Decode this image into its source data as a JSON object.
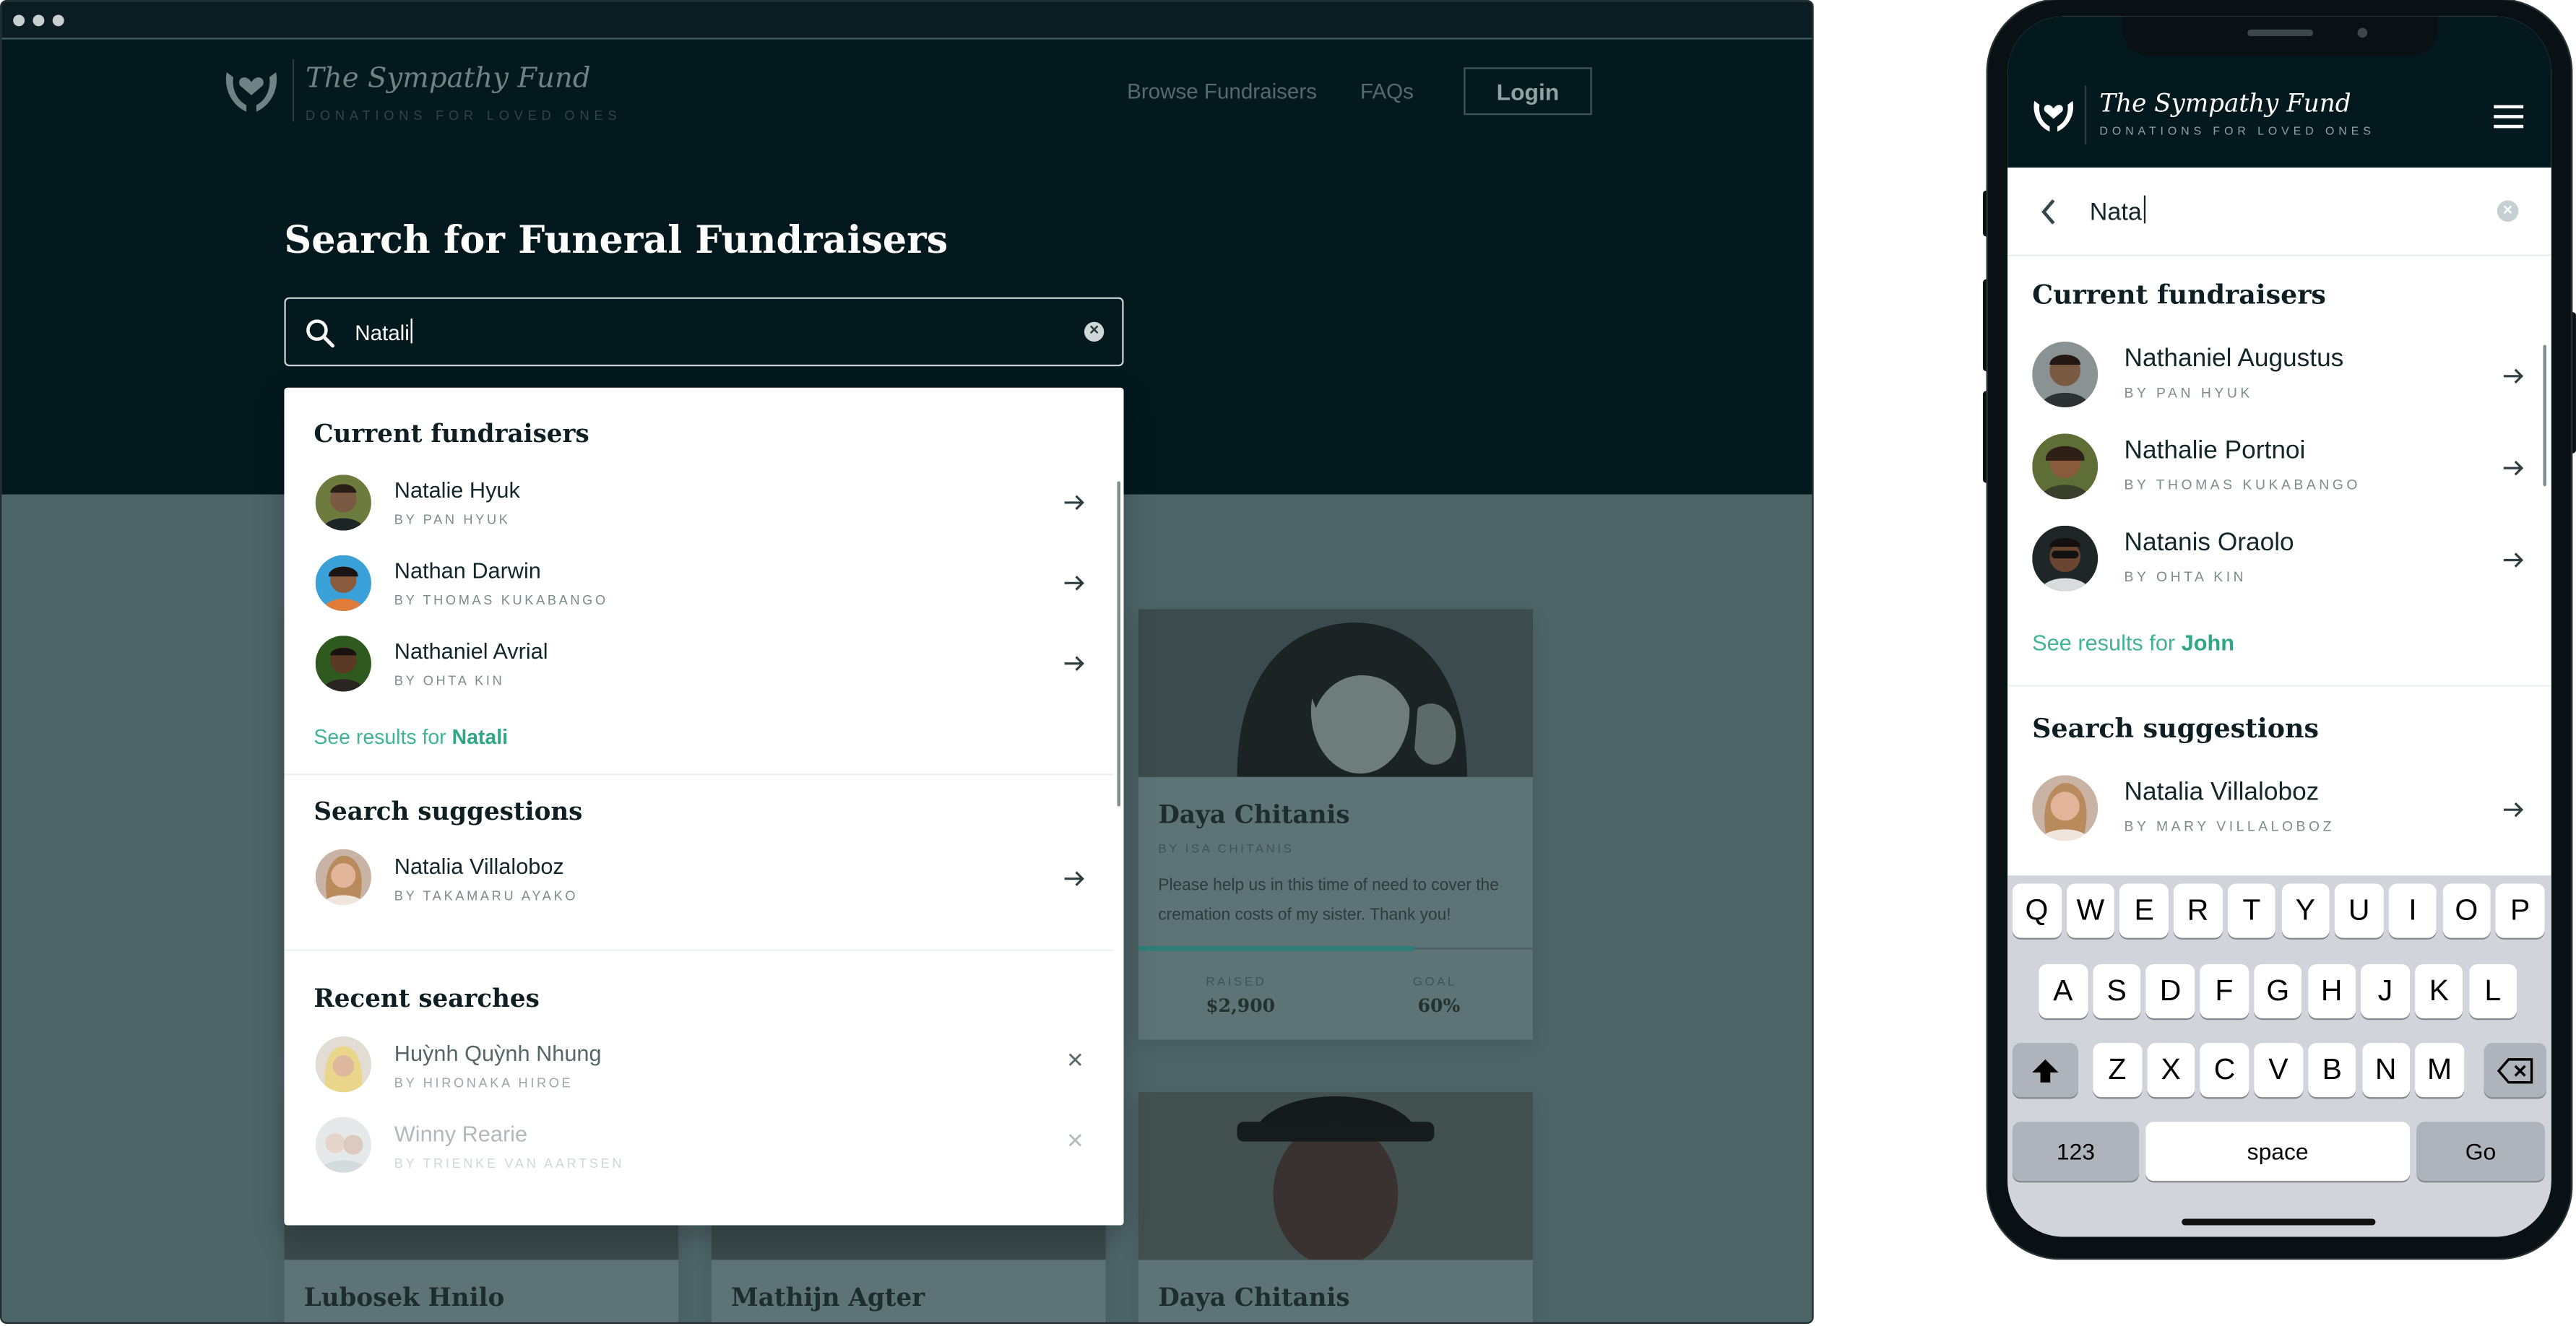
{
  "brand": {
    "name": "The Sympathy Fund",
    "tagline": "DONATIONS FOR LOVED ONES"
  },
  "desktop": {
    "nav": {
      "browse": "Browse Fundraisers",
      "faqs": "FAQs",
      "login": "Login"
    },
    "hero_title": "Search for Funeral Fundraisers",
    "search": {
      "value": "Natali",
      "clear_icon": "clear-circle-icon"
    },
    "dropdown": {
      "current_title": "Current fundraisers",
      "current": [
        {
          "name": "Natalie Hyuk",
          "by": "BY PAN HYUK"
        },
        {
          "name": "Nathan Darwin",
          "by": "BY THOMAS KUKABANGO"
        },
        {
          "name": "Nathaniel Avrial",
          "by": "BY OHTA KIN"
        }
      ],
      "see_results_prefix": "See results for ",
      "see_results_term": "Natali",
      "suggestions_title": "Search suggestions",
      "suggestions": [
        {
          "name": "Natalia Villaloboz",
          "by": "BY TAKAMARU AYAKO"
        }
      ],
      "recent_title": "Recent searches",
      "recent": [
        {
          "name": "Huỳnh Quỳnh Nhung",
          "by": "BY HIRONAKA HIROE"
        },
        {
          "name": "Winny Rearie",
          "by": "BY TRIENKE VAN AARTSEN"
        }
      ]
    },
    "cards": {
      "featured": {
        "name": "Daya Chitanis",
        "by": "BY ISA CHITANIS",
        "description": "Please help us in this time of need to cover the cremation costs of my sister.  Thank you!",
        "raised_label": "RAISED",
        "raised_value": "$2,900",
        "goal_label": "GOAL",
        "goal_value": "60%",
        "progress": 0.7
      },
      "bottom": [
        {
          "name": "Lubosek Hnilo"
        },
        {
          "name": "Mathijn Agter"
        },
        {
          "name": "Daya Chitanis"
        }
      ]
    }
  },
  "mobile": {
    "search": {
      "value": "Nata",
      "back_icon": "chevron-left-icon",
      "clear_icon": "clear-circle-icon"
    },
    "current_title": "Current fundraisers",
    "current": [
      {
        "name": "Nathaniel Augustus",
        "by": "BY PAN HYUK"
      },
      {
        "name": "Nathalie Portnoi",
        "by": "BY THOMAS KUKABANGO"
      },
      {
        "name": "Natanis Oraolo",
        "by": "BY OHTA KIN"
      }
    ],
    "see_results_prefix": "See results for ",
    "see_results_term": "John",
    "suggestions_title": "Search suggestions",
    "suggestions": [
      {
        "name": "Natalia Villaloboz",
        "by": "BY MARY VILLALOBOZ"
      }
    ],
    "keyboard": {
      "row1": [
        "Q",
        "W",
        "E",
        "R",
        "T",
        "Y",
        "U",
        "I",
        "O",
        "P"
      ],
      "row2": [
        "A",
        "S",
        "D",
        "F",
        "G",
        "H",
        "J",
        "K",
        "L"
      ],
      "row3": [
        "Z",
        "X",
        "C",
        "V",
        "B",
        "N",
        "M"
      ],
      "numbers": "123",
      "space": "space",
      "go": "Go"
    }
  },
  "colors": {
    "hero_bg": "#03191e",
    "page_overlay": "#4e6568",
    "accent_green": "#3fb595",
    "text_dark": "#15262a"
  }
}
